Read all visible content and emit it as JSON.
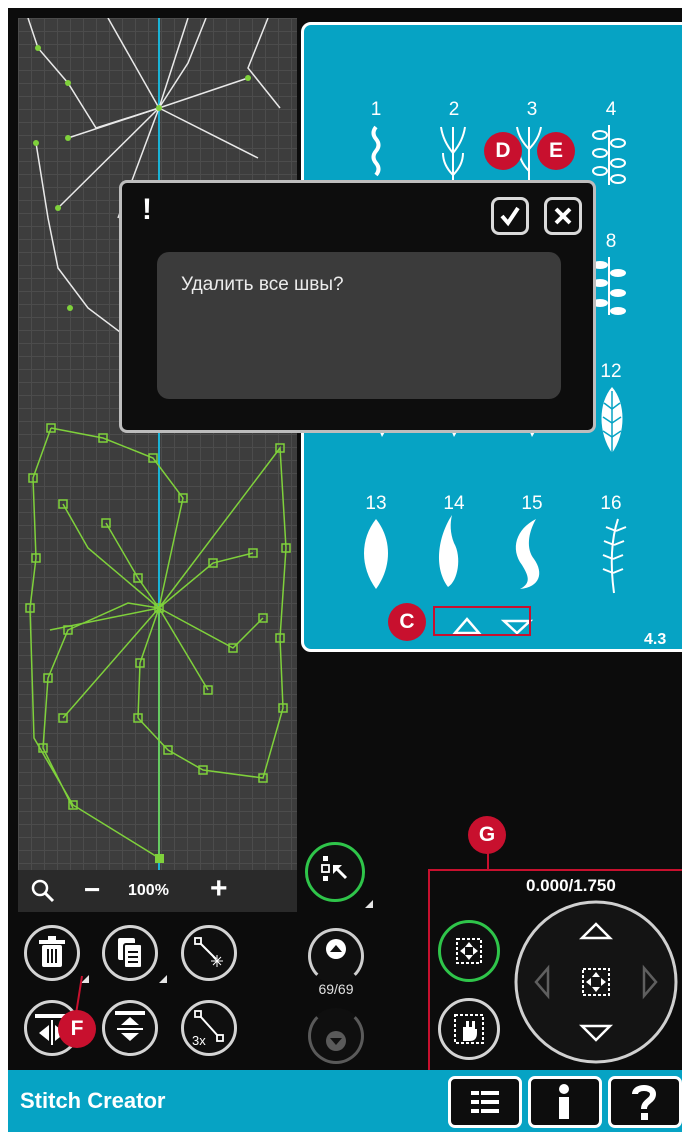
{
  "dialog": {
    "icon": "!",
    "message": "Удалить все швы?"
  },
  "stitch_menu": {
    "numbers": [
      "1",
      "2",
      "3",
      "4",
      "8",
      "12",
      "13",
      "14",
      "15",
      "16"
    ],
    "page": "4.3"
  },
  "zoom": {
    "minus": "−",
    "level": "100%",
    "plus": "+"
  },
  "stitch_counter": "69/69",
  "position_readout": "0.000/1.750",
  "callouts": {
    "c": "C",
    "d": "D",
    "e": "E",
    "f": "F",
    "g": "G"
  },
  "footer": {
    "title": "Stitch Creator"
  },
  "colors": {
    "accent": "#06a3c4",
    "callout": "#c8102e",
    "active_green": "#2fc54a",
    "stitch_green": "#7fd13b"
  },
  "icons": [
    "confirm-checkmark-icon",
    "stitch-icon",
    "zoom-icon",
    "trash-icon",
    "copy-icon",
    "single-stitch-icon",
    "mirror-side-icon",
    "mirror-end-icon",
    "triple-stitch-icon",
    "select-point-icon",
    "arrow-up-icon",
    "arrow-down-icon",
    "center-icon",
    "pan-icon",
    "menu-list-icon",
    "info-icon",
    "help-icon",
    "close-icon"
  ]
}
